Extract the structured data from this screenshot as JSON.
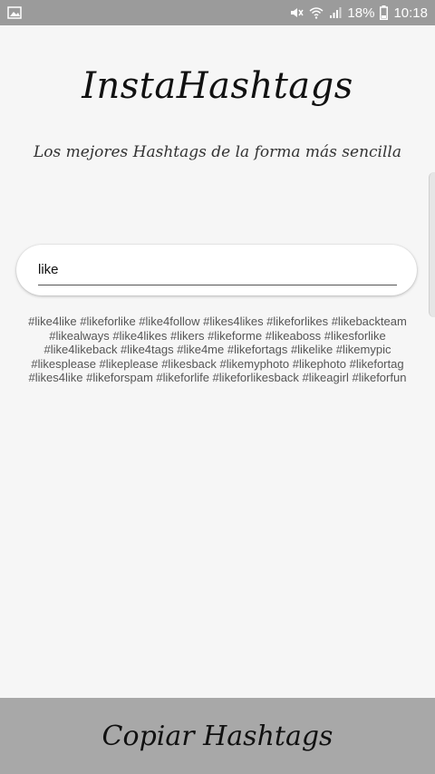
{
  "status_bar": {
    "battery": "18%",
    "time": "10:18",
    "icons": [
      "image-icon",
      "mute-icon",
      "wifi-icon",
      "signal-icon",
      "battery-icon"
    ]
  },
  "app": {
    "title": "InstaHashtags",
    "subtitle": "Los mejores Hashtags de la forma más sencilla"
  },
  "search": {
    "value": "like",
    "placeholder": ""
  },
  "hashtags": {
    "lines": [
      "#like4like #likeforlike #like4follow #likes4likes #likeforlikes #likebackteam",
      "#likealways #like4likes #likers #likeforme #likeaboss #likesforlike",
      "#like4likeback #like4tags #like4me #likefortags #likelike #likemypic",
      "#likesplease #likeplease #likesback #likemyphoto #likephoto #likefortag",
      "#likes4like #likeforspam #likeforlife #likeforlikesback #likeagirl #likeforfun"
    ]
  },
  "copy_button": {
    "label": "Copiar Hashtags"
  },
  "colors": {
    "status_bar": "#9b9b9b",
    "background": "#f6f6f6",
    "bottom_button": "#a8a8a8",
    "hashtag_text": "#555555"
  }
}
